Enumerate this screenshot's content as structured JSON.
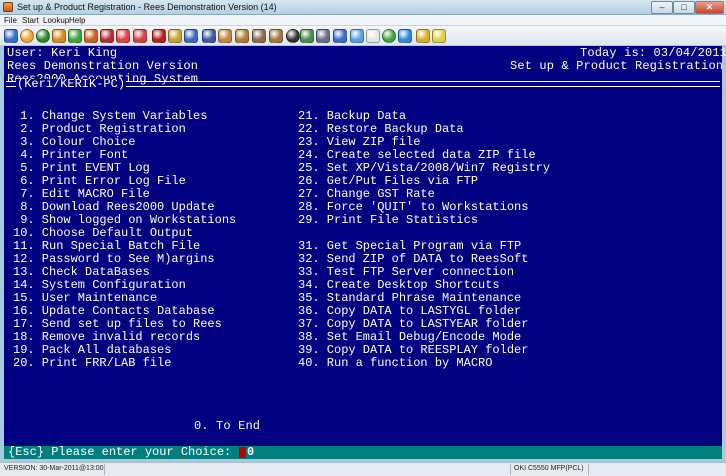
{
  "window": {
    "title": "Set up & Product Registration - Rees Demonstration Version (14)"
  },
  "menubar": {
    "items": [
      "File",
      "Start",
      "Lookup",
      "Help"
    ]
  },
  "toolbar": {
    "icons": [
      {
        "name": "back-arrow-icon",
        "color": "#2e6fd0"
      },
      {
        "name": "help-circle-icon",
        "color": "#f2a32a"
      },
      {
        "name": "info-circle-icon",
        "color": "#2a8a2a"
      },
      {
        "name": "person-group-icon",
        "color": "#d48a1a"
      },
      {
        "name": "leaf-icon",
        "color": "#3aa53a"
      },
      {
        "name": "user-edit-icon",
        "color": "#c86020"
      },
      {
        "name": "user-badge-icon",
        "color": "#b23030"
      },
      {
        "name": "calendar-2-icon",
        "color": "#e04040"
      },
      {
        "name": "clock-icon",
        "color": "#d84040"
      },
      {
        "name": "book-icon",
        "color": "#b81c1c"
      },
      {
        "name": "folder-icon",
        "color": "#c8a02a"
      },
      {
        "name": "people-icon",
        "color": "#3a68c0"
      },
      {
        "name": "user-blue-icon",
        "color": "#3a58a0"
      },
      {
        "name": "package-icon",
        "color": "#c08a3a"
      },
      {
        "name": "box-open-icon",
        "color": "#b07a30"
      },
      {
        "name": "truck-icon",
        "color": "#8a6a4a"
      },
      {
        "name": "crate-icon",
        "color": "#a0783a"
      },
      {
        "name": "tyre-icon",
        "color": "#333333"
      },
      {
        "name": "pen-icon",
        "color": "#4a8a4a"
      },
      {
        "name": "lasso-icon",
        "color": "#6a6a8a"
      },
      {
        "name": "list-icon",
        "color": "#3a6ad0"
      },
      {
        "name": "filter-icon",
        "color": "#5aa0e0"
      },
      {
        "name": "document-icon",
        "color": "#e6e6e6"
      },
      {
        "name": "globe-icon",
        "color": "#3aa83a"
      },
      {
        "name": "at-sign-icon",
        "color": "#2e8ae0"
      },
      {
        "name": "lock-icon",
        "color": "#d8b02a"
      },
      {
        "name": "car-icon",
        "color": "#e0d040"
      }
    ]
  },
  "terminal": {
    "user_line": "User: Keri King",
    "date_line": "Today is: 03/04/2011",
    "version_line": "Rees Demonstration Version",
    "screen_title": "Set up & Product Registration",
    "system_line": "Rees2000 Accounting System",
    "workstation_label": "(Keri/KERIK-PC)",
    "options_col1": [
      " 1. Change System Variables",
      " 2. Product Registration",
      " 3. Colour Choice",
      " 4. Printer Font",
      " 5. Print EVENT Log",
      " 6. Print Error Log File",
      " 7. Edit MACRO File",
      " 8. Download Rees2000 Update",
      " 9. Show logged on Workstations",
      "10. Choose Default Output",
      "11. Run Special Batch File",
      "12. Password to See M)argins",
      "13. Check DataBases",
      "14. System Configuration",
      "15. User Maintenance",
      "16. Update Contacts Database",
      "17. Send set up files to Rees",
      "18. Remove invalid records",
      "19. Pack All databases",
      "20. Print FRR/LAB file"
    ],
    "options_col2": [
      "21. Backup Data",
      "22. Restore Backup Data",
      "23. View ZIP file",
      "24. Create selected data ZIP file",
      "25. Set XP/Vista/2008/Win7 Registry",
      "26. Get/Put Files via FTP",
      "27. Change GST Rate",
      "28. Force 'QUIT' to Workstations",
      "29. Print File Statistics",
      "",
      "31. Get Special Program via FTP",
      "32. Send ZIP of DATA to ReesSoft",
      "33. Test FTP Server connection",
      "34. Create Desktop Shortcuts",
      "35. Standard Phrase Maintenance",
      "36. Copy DATA to LASTYGL folder",
      "37. Copy DATA to LASTYEAR folder",
      "38. Set Email Debug/Encode Mode",
      "39. Copy DATA to REESPLAY folder",
      "40. Run a function by MACRO"
    ],
    "end_option": "0. To End",
    "prompt": "{Esc} Please enter your Choice:",
    "choice_value": "0"
  },
  "status": {
    "version": "VERSION: 30-Mar-2011@13:00",
    "printer": "OKI C5550 MFP(PCL)"
  }
}
